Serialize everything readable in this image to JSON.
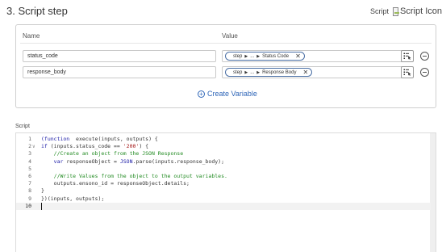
{
  "header": {
    "step_title": "3.  Script step",
    "type_label": "Script",
    "type_icon_alt": "Script Icon"
  },
  "variables": {
    "columns": {
      "name": "Name",
      "value": "Value"
    },
    "rows": [
      {
        "name": "status_code",
        "step": "step",
        "ellipsis": "...",
        "field": "Status Code"
      },
      {
        "name": "response_body",
        "step": "step",
        "ellipsis": "...",
        "field": "Response Body"
      }
    ],
    "create_label": "Create Variable"
  },
  "script": {
    "label": "Script",
    "active_line": 10,
    "lines": [
      {
        "n": "1",
        "fold": "",
        "tokens": [
          [
            "k",
            "(function"
          ],
          [
            "",
            "  execute(inputs, outputs) {"
          ]
        ]
      },
      {
        "n": "2",
        "fold": "∨",
        "tokens": [
          [
            "k",
            "if"
          ],
          [
            "",
            " (inputs.status_code == "
          ],
          [
            "s",
            "'200'"
          ],
          [
            "",
            ") {"
          ]
        ]
      },
      {
        "n": "3",
        "fold": "",
        "tokens": [
          [
            "",
            "    "
          ],
          [
            "c",
            "//Create an object from the JSON Response"
          ]
        ]
      },
      {
        "n": "4",
        "fold": "",
        "tokens": [
          [
            "",
            "    "
          ],
          [
            "k",
            "var"
          ],
          [
            "",
            " responseObject = "
          ],
          [
            "k",
            "JSON"
          ],
          [
            "",
            ".parse(inputs.response_body);"
          ]
        ]
      },
      {
        "n": "5",
        "fold": "",
        "tokens": []
      },
      {
        "n": "6",
        "fold": "",
        "tokens": [
          [
            "",
            "    "
          ],
          [
            "c",
            "//Write Values from the object to the output variables."
          ]
        ]
      },
      {
        "n": "7",
        "fold": "",
        "tokens": [
          [
            "",
            "    outputs.ensono_id = responseObject.details;"
          ]
        ]
      },
      {
        "n": "8",
        "fold": "",
        "tokens": [
          [
            "",
            "}"
          ]
        ]
      },
      {
        "n": "9",
        "fold": "",
        "tokens": [
          [
            "",
            "})(inputs, outputs);"
          ]
        ]
      },
      {
        "n": "10",
        "fold": "",
        "tokens": []
      }
    ]
  },
  "colors": {
    "link": "#2f66b8",
    "pill_border": "#4a6fa5",
    "comment": "#228b22",
    "keyword": "#1a1aa6"
  }
}
